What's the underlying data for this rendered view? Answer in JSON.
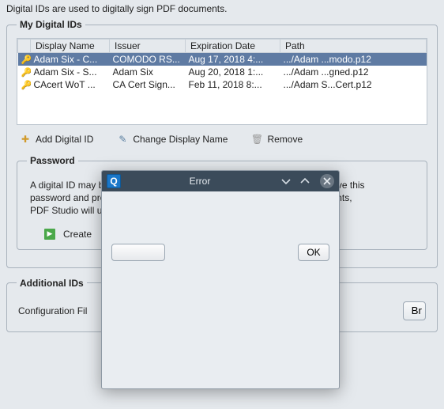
{
  "intro": "Digital IDs are used to digitally sign PDF documents.",
  "myids": {
    "legend": "My Digital IDs",
    "headers": {
      "display_name": "Display Name",
      "issuer": "Issuer",
      "expiration": "Expiration Date",
      "path": "Path"
    },
    "rows": [
      {
        "display_name": "Adam Six - C...",
        "issuer": "COMODO RS...",
        "expiration": "Aug 17, 2018 4:...",
        "path": ".../Adam ...modo.p12",
        "selected": true
      },
      {
        "display_name": "Adam Six - S...",
        "issuer": "Adam Six",
        "expiration": "Aug 20, 2018 1:...",
        "path": ".../Adam ...gned.p12",
        "selected": false
      },
      {
        "display_name": "CAcert WoT ...",
        "issuer": "CA Cert Sign...",
        "expiration": "Feb 11, 2018 8:...",
        "path": ".../Adam S...Cert.p12",
        "selected": false
      }
    ],
    "actions": {
      "add": "Add Digital ID",
      "change": "Change Display Name",
      "remove": "Remove"
    }
  },
  "password": {
    "legend": "Password",
    "text_line1": "A digital ID may be protected by a complex password. PDF Studio can save this",
    "text_line2": "password and protect it using your own password. When signing documents,",
    "text_line3": "PDF Studio will use your password.",
    "create": "Create"
  },
  "additional": {
    "legend": "Additional IDs",
    "config_label": "Configuration Fil",
    "browse": "Br"
  },
  "modal": {
    "title": "Error",
    "left_button": "",
    "ok": "OK"
  }
}
